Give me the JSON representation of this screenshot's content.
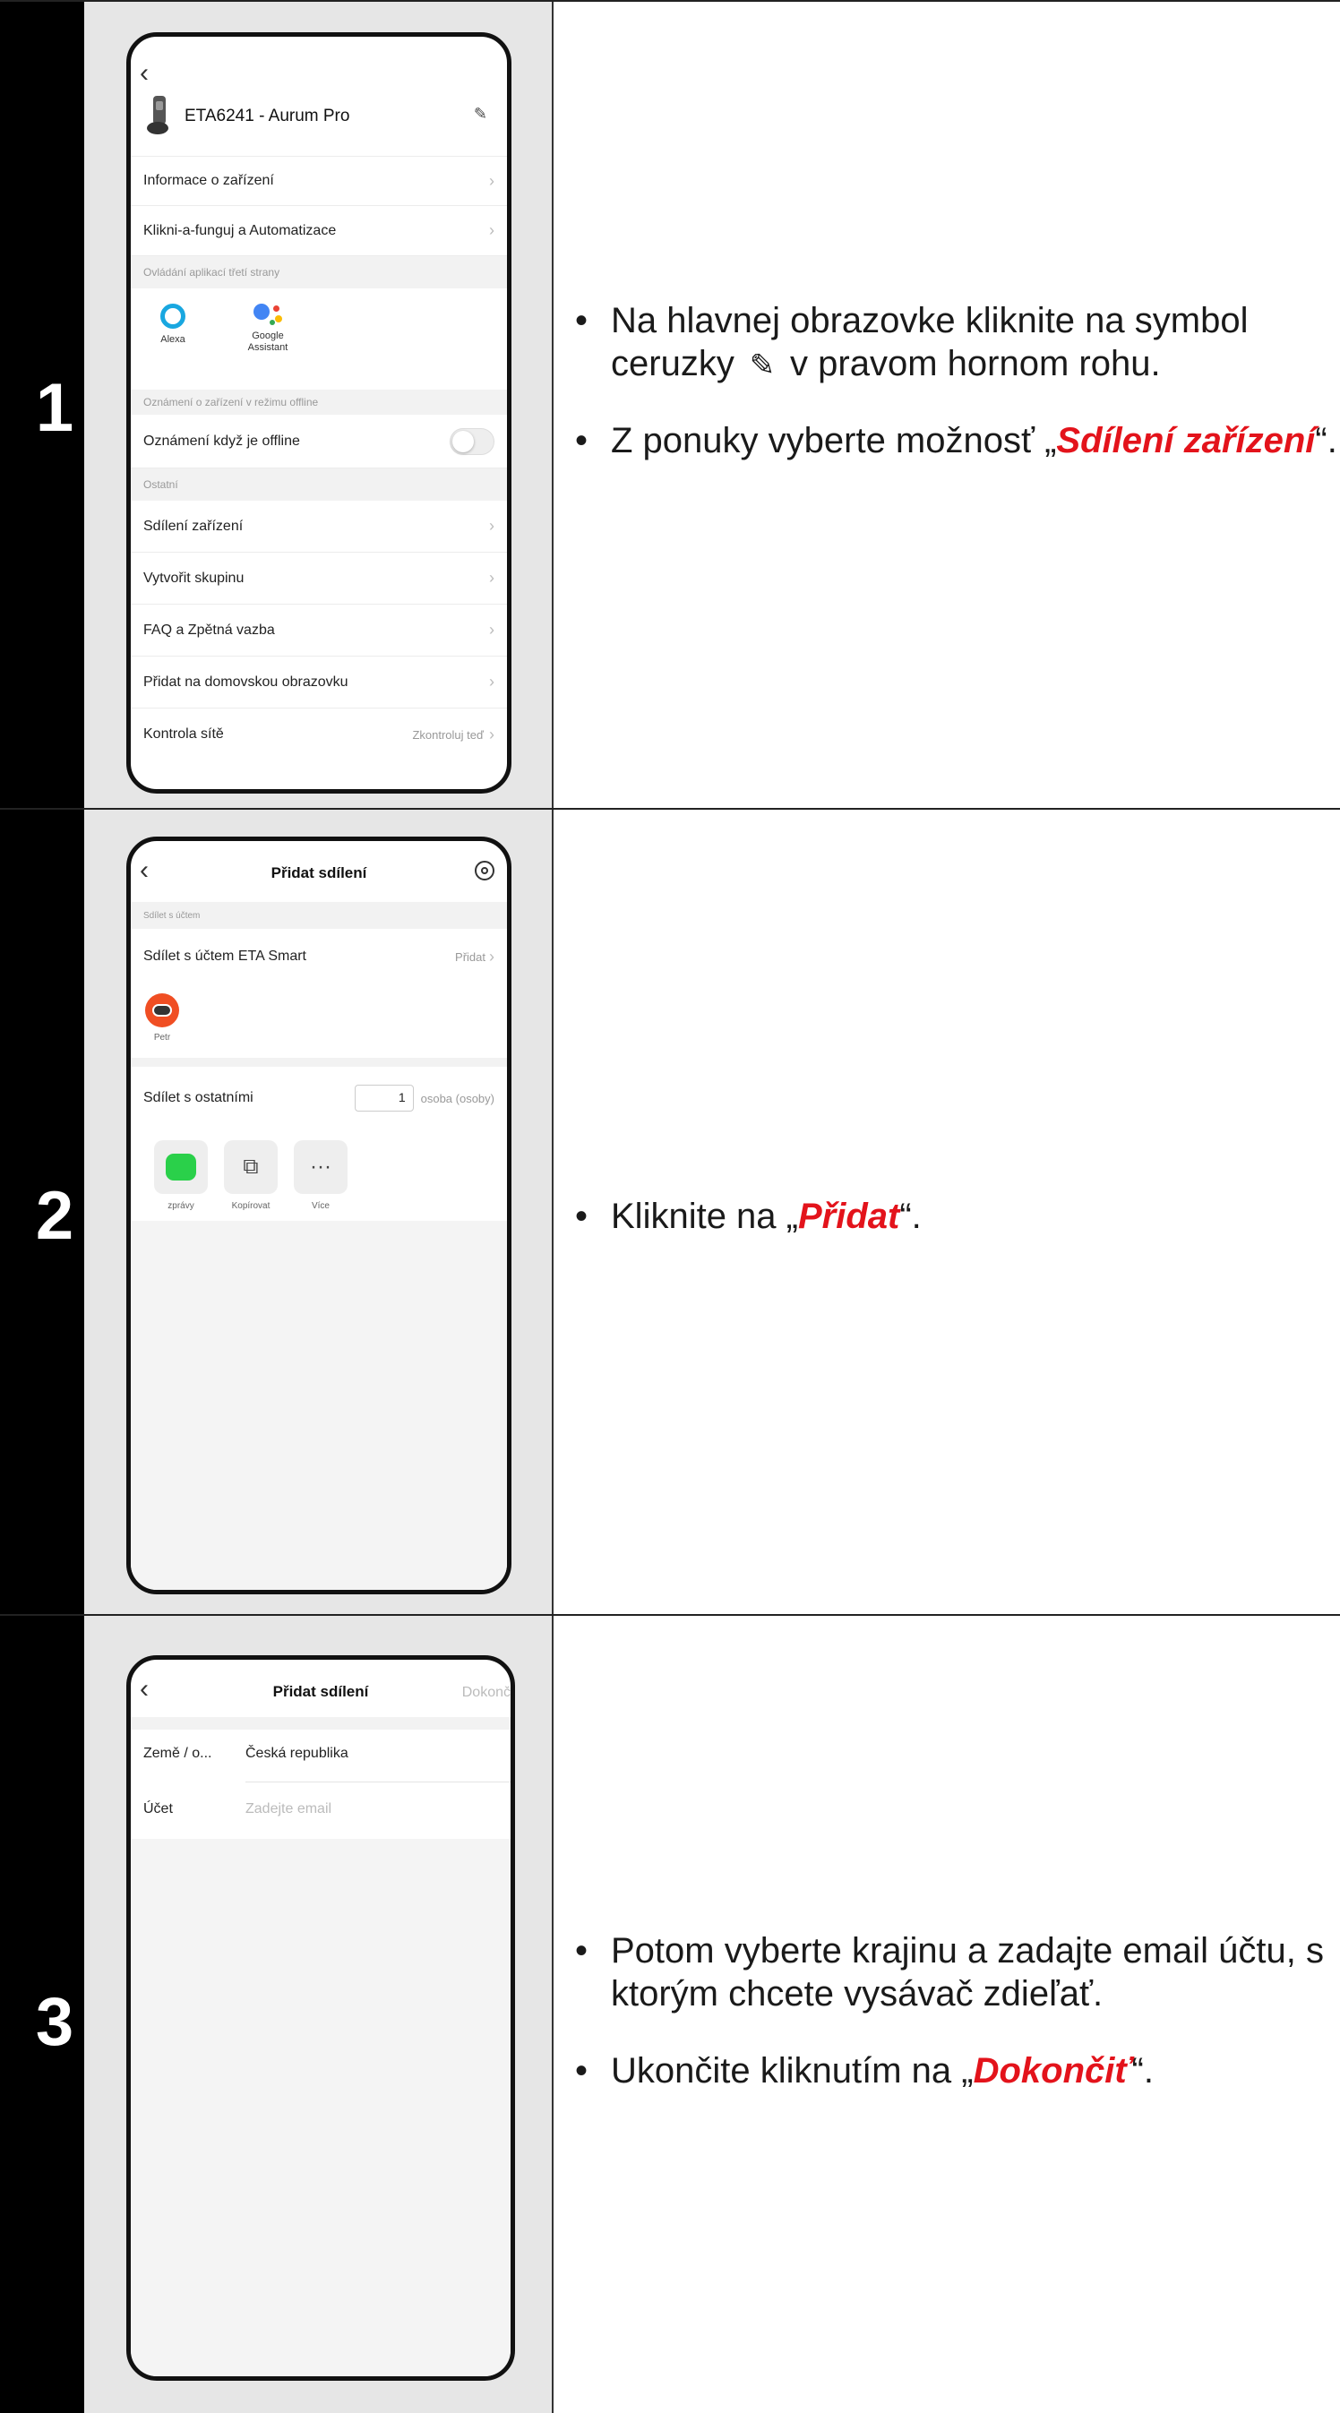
{
  "steps": [
    {
      "number": "1",
      "bullets": [
        {
          "before": "Na hlavnej obrazovke kliknite na symbol ceruzky ",
          "icon": "pencil-icon",
          "after": " v pravom hornom rohu."
        },
        {
          "before": "Z ponuky vyberte možnosť „",
          "highlight": "Sdílení zařízení",
          "after": "“."
        }
      ],
      "screen": {
        "device_name": "ETA6241 - Aurum Pro",
        "items": [
          "Informace o zařízení",
          "Klikni-a-funguj a Automatizace"
        ],
        "section_third_party": "Ovládání aplikací třetí strany",
        "alexa_label": "Alexa",
        "google_label": "Google Assistant",
        "section_offline": "Oznámení o zařízení v režimu offline",
        "offline_toggle_label": "Oznámení když je offline",
        "section_other": "Ostatní",
        "other_items": [
          "Sdílení zařízení",
          "Vytvořit skupinu",
          "FAQ a Zpětná vazba",
          "Přidat na domovskou obrazovku"
        ],
        "network_label": "Kontrola sítě",
        "network_action": "Zkontroluj teď"
      }
    },
    {
      "number": "2",
      "bullets": [
        {
          "before": "Kliknite na „",
          "highlight": "Přidat",
          "after": "“."
        }
      ],
      "screen": {
        "title": "Přidat sdílení",
        "section_account": "Sdílet s účtem",
        "share_account_label": "Sdílet s účtem ETA Smart",
        "add_label": "Přidat",
        "user_name": "Petr",
        "share_others_label": "Sdílet s ostatními",
        "persons_count": "1",
        "persons_unit": "osoba (osoby)",
        "apps": [
          "zprávy",
          "Kopírovat",
          "Více"
        ]
      }
    },
    {
      "number": "3",
      "bullets": [
        {
          "before": "Potom vyberte krajinu a zadajte email účtu, s ktorým chcete vysávač zdieľať.",
          "after": ""
        },
        {
          "before": "Ukončite kliknutím na „",
          "highlight": "Dokončiť",
          "after": "“."
        }
      ],
      "screen": {
        "title": "Přidat sdílení",
        "done_label": "Dokonč",
        "country_label": "Země / o...",
        "country_value": "Česká republika",
        "account_label": "Účet",
        "account_placeholder": "Zadejte email"
      }
    }
  ]
}
